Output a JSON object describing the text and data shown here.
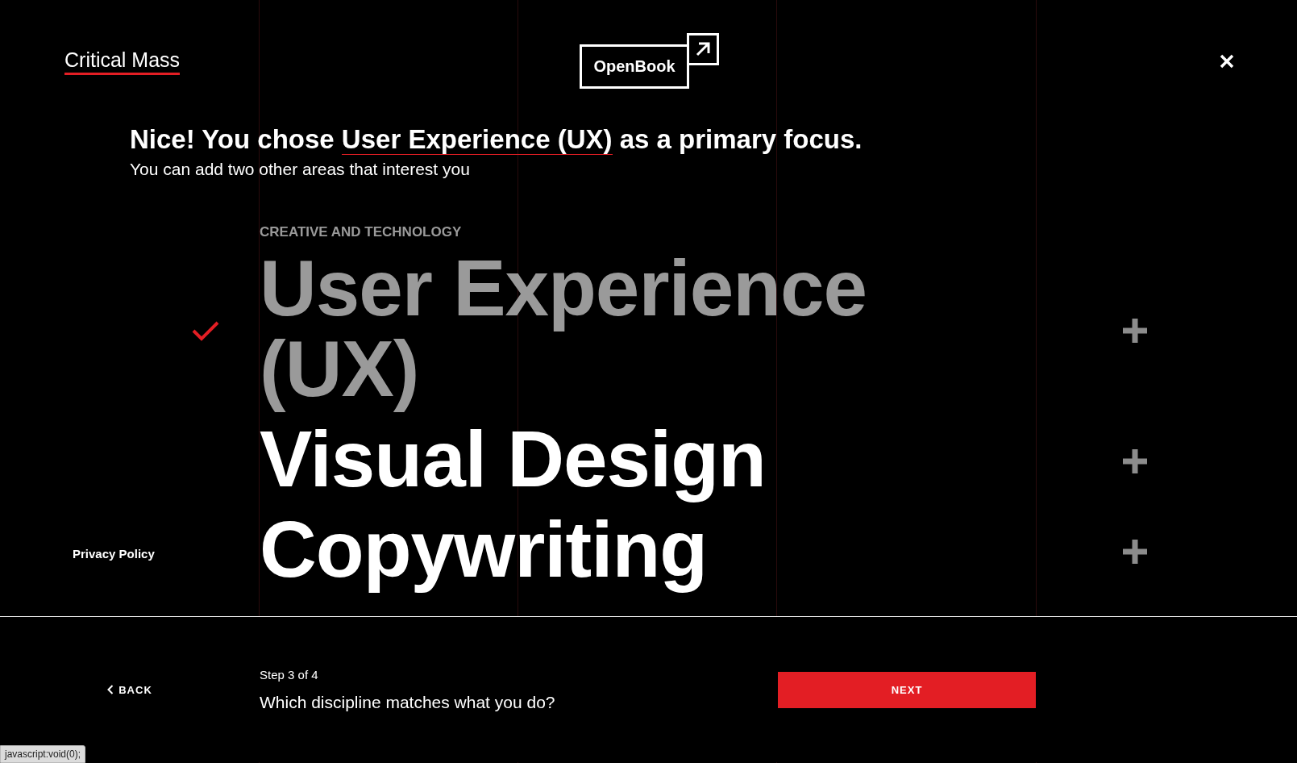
{
  "header": {
    "brand": "Critical Mass",
    "product": "OpenBook"
  },
  "headline": {
    "before": "Nice! You chose ",
    "highlight": "User Experience (UX)",
    "after": " as a primary focus.",
    "subtitle": "You can add two other areas that interest you"
  },
  "category": "CREATIVE AND TECHNOLOGY",
  "disciplines": [
    {
      "label": "User Experience (UX)",
      "selected": true
    },
    {
      "label": "Visual Design",
      "selected": false
    },
    {
      "label": "Copywriting",
      "selected": false
    }
  ],
  "side_link": "Privacy Policy",
  "footer": {
    "back": "BACK",
    "step": "Step 3 of 4",
    "question": "Which discipline matches what you do?",
    "next": "NEXT"
  },
  "status_bar": "javascript:void(0);"
}
